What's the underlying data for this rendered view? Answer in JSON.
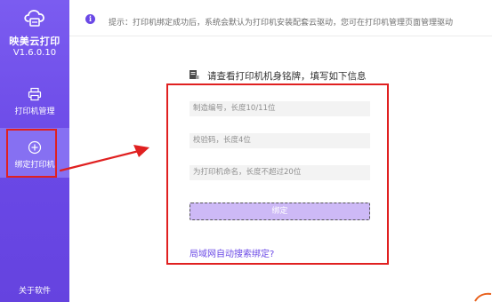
{
  "sidebar": {
    "app_name": "映美云打印",
    "version": "V1.6.0.10",
    "items": [
      {
        "label": "打印机管理",
        "icon": "printer-icon"
      },
      {
        "label": "绑定打印机",
        "icon": "plus-circle-icon"
      }
    ],
    "about_label": "关于软件"
  },
  "tip": {
    "icon": "info-icon",
    "text": "提示：打印机绑定成功后，系统会默认为打印机安装配套云驱动，您可在打印机管理页面管理驱动"
  },
  "form": {
    "title": "请查看打印机机身铭牌，填写如下信息",
    "serial_placeholder": "制造编号，长度10/11位",
    "check_placeholder": "校验码，长度4位",
    "name_placeholder": "为打印机命名，长度不超过20位",
    "bind_label": "绑定",
    "lan_link": "局域网自动搜索绑定?"
  },
  "colors": {
    "sidebar": "#6a48e6",
    "highlight": "#e02020",
    "bind_button": "#cdb9f6",
    "link": "#6a48e6"
  }
}
